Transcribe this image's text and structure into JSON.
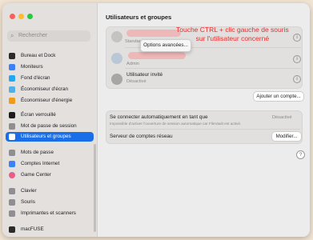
{
  "colors": {
    "accent": "#1a6fe8",
    "annotation": "#ea2c2c",
    "desktop": "#f2e4d3"
  },
  "sidebar": {
    "search_placeholder": "Rechercher",
    "items": [
      {
        "label": "Bureau et Dock",
        "icon": "dock-icon",
        "color": "#2b2b2b"
      },
      {
        "label": "Moniteurs",
        "icon": "display-icon",
        "color": "#3b82f6"
      },
      {
        "label": "Fond d'écran",
        "icon": "wallpaper-icon",
        "color": "#22a7f0"
      },
      {
        "label": "Économiseur d'écran",
        "icon": "screensaver-icon",
        "color": "#4fb0e8"
      },
      {
        "label": "Économiseur d'énergie",
        "icon": "energy-icon",
        "color": "#f29b16"
      },
      {
        "label": "Écran verrouillé",
        "icon": "lock-screen-icon",
        "color": "#1c1c1e"
      },
      {
        "label": "Mot de passe de session",
        "icon": "login-password-icon",
        "color": "#8e8e93"
      },
      {
        "label": "Utilisateurs et groupes",
        "icon": "users-icon",
        "color": "#ffffff"
      },
      {
        "label": "Mots de passe",
        "icon": "key-icon",
        "color": "#8e8e93"
      },
      {
        "label": "Comptes Internet",
        "icon": "at-icon",
        "color": "#3b82f6"
      },
      {
        "label": "Game Center",
        "icon": "game-center-icon",
        "color": "#e85d8a"
      },
      {
        "label": "Clavier",
        "icon": "keyboard-icon",
        "color": "#8e8e93"
      },
      {
        "label": "Souris",
        "icon": "mouse-icon",
        "color": "#8e8e93"
      },
      {
        "label": "Imprimantes et scanners",
        "icon": "printer-icon",
        "color": "#8e8e93"
      },
      {
        "label": "macFUSE",
        "icon": "macfuse-icon",
        "color": "#2b2b2b"
      }
    ],
    "selected_label": "Utilisateurs et groupes"
  },
  "main": {
    "title": "Utilisateurs et groupes",
    "users": [
      {
        "role": "Standard"
      },
      {
        "role": "Admin"
      },
      {
        "name": "Utilisateur invité",
        "status": "Désactivé"
      }
    ],
    "context_menu": "Options avancées...",
    "add_account_button": "Ajouter un compte...",
    "auto_login": {
      "label": "Se connecter automatiquement en tant que",
      "value": "Désactivé",
      "note": "Impossible d'activer l'ouverture de session automatique car FileVault est activé."
    },
    "network_server": {
      "label": "Serveur de comptes réseau",
      "button": "Modifier..."
    },
    "help": "?"
  },
  "annotation": {
    "line1": "Touche CTRL + clic gauche de souris",
    "line2": "sur l'utilisateur concerné"
  }
}
